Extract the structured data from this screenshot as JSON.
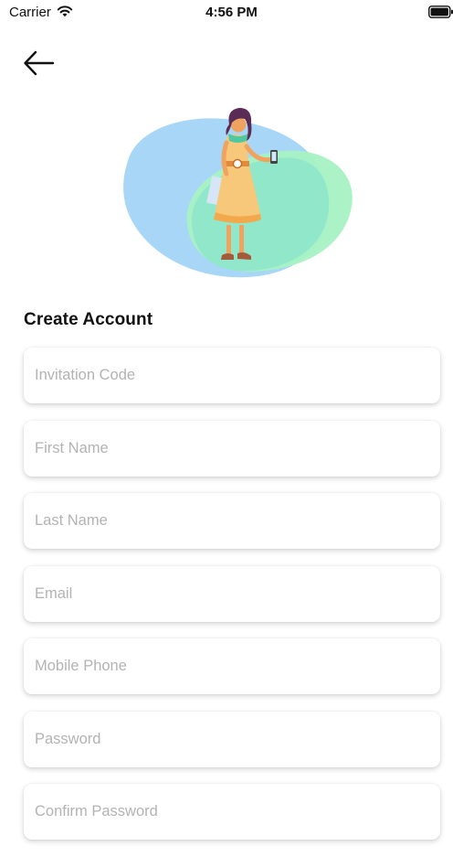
{
  "status_bar": {
    "carrier": "Carrier",
    "time": "4:56 PM",
    "icons": [
      "wifi-icon",
      "battery-icon"
    ]
  },
  "nav": {
    "back_icon": "arrow-left-icon"
  },
  "illustration": {
    "name": "woman-shopping-illustration",
    "colors": {
      "blob_blue": "#a8d6f7",
      "blob_green": "#a6f2c4",
      "blob_overlap": "#8ee6c9",
      "dress": "#f7c87a",
      "hair": "#5a2b55"
    }
  },
  "title": "Create Account",
  "form": {
    "fields": [
      {
        "name": "invitation-code-field",
        "placeholder": "Invitation Code",
        "value": ""
      },
      {
        "name": "first-name-field",
        "placeholder": "First Name",
        "value": ""
      },
      {
        "name": "last-name-field",
        "placeholder": "Last Name",
        "value": ""
      },
      {
        "name": "email-field",
        "placeholder": "Email",
        "value": ""
      },
      {
        "name": "mobile-phone-field",
        "placeholder": "Mobile Phone",
        "value": ""
      },
      {
        "name": "password-field",
        "placeholder": "Password",
        "value": ""
      },
      {
        "name": "confirm-password-field",
        "placeholder": "Confirm Password",
        "value": ""
      }
    ]
  }
}
